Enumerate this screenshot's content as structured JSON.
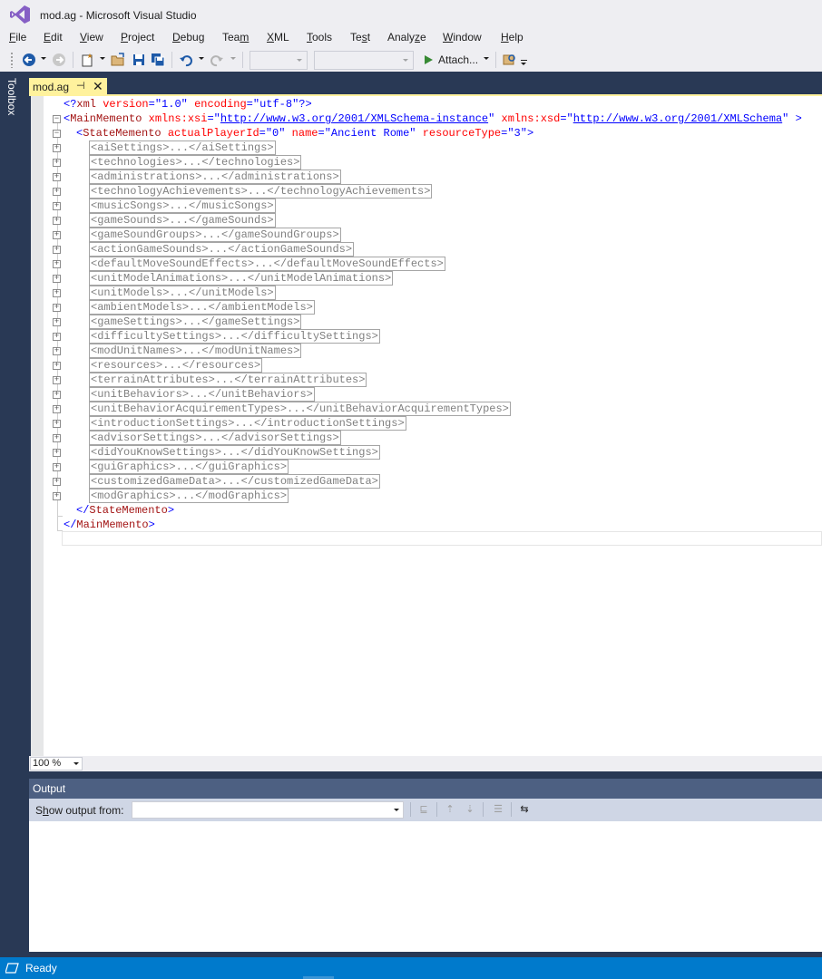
{
  "window": {
    "title": "mod.ag - Microsoft Visual Studio"
  },
  "menu": [
    {
      "label": "File",
      "u": "F",
      "rest": "ile"
    },
    {
      "label": "Edit",
      "u": "E",
      "rest": "dit"
    },
    {
      "label": "View",
      "u": "V",
      "rest": "iew"
    },
    {
      "label": "Project",
      "u": "P",
      "rest": "roject"
    },
    {
      "label": "Debug",
      "u": "D",
      "rest": "ebug"
    },
    {
      "label": "Team",
      "pre": "Tea",
      "u": "m",
      "rest": ""
    },
    {
      "label": "XML",
      "u": "X",
      "rest": "ML"
    },
    {
      "label": "Tools",
      "u": "T",
      "rest": "ools"
    },
    {
      "label": "Test",
      "pre": "Te",
      "u": "s",
      "rest": "t"
    },
    {
      "label": "Analyze",
      "pre": "Analy",
      "u": "z",
      "rest": "e"
    },
    {
      "label": "Window",
      "u": "W",
      "rest": "indow"
    },
    {
      "label": "Help",
      "u": "H",
      "rest": "elp"
    }
  ],
  "toolbar": {
    "attach_label": "Attach..."
  },
  "toolbox": {
    "label": "Toolbox"
  },
  "document_tab": {
    "label": "mod.ag",
    "pin": "⊣",
    "close": "✕"
  },
  "editor": {
    "xml_decl": {
      "open": "<?",
      "name": "xml",
      "attr1": "version",
      "val1": "\"1.0\"",
      "attr2": "encoding",
      "val2": "\"utf-8\"",
      "close": "?>"
    },
    "main_open": {
      "lt": "<",
      "name": "MainMemento",
      "attr1": "xmlns:xsi",
      "val1": "http://www.w3.org/2001/XMLSchema-instance",
      "attr2": "xmlns:xsd",
      "val2": "http://www.w3.org/2001/XMLSchema",
      "gt": ">"
    },
    "state_open": {
      "name": "StateMemento",
      "attr1": "actualPlayerId",
      "val1": "\"0\"",
      "attr2": "name",
      "val2": "\"Ancient Rome\"",
      "attr3": "resourceType",
      "val3": "\"3\""
    },
    "collapsed_nodes": [
      "<aiSettings>...</aiSettings>",
      "<technologies>...</technologies>",
      "<administrations>...</administrations>",
      "<technologyAchievements>...</technologyAchievements>",
      "<musicSongs>...</musicSongs>",
      "<gameSounds>...</gameSounds>",
      "<gameSoundGroups>...</gameSoundGroups>",
      "<actionGameSounds>...</actionGameSounds>",
      "<defaultMoveSoundEffects>...</defaultMoveSoundEffects>",
      "<unitModelAnimations>...</unitModelAnimations>",
      "<unitModels>...</unitModels>",
      "<ambientModels>...</ambientModels>",
      "<gameSettings>...</gameSettings>",
      "<difficultySettings>...</difficultySettings>",
      "<modUnitNames>...</modUnitNames>",
      "<resources>...</resources>",
      "<terrainAttributes>...</terrainAttributes>",
      "<unitBehaviors>...</unitBehaviors>",
      "<unitBehaviorAcquirementTypes>...</unitBehaviorAcquirementTypes>",
      "<introductionSettings>...</introductionSettings>",
      "<advisorSettings>...</advisorSettings>",
      "<didYouKnowSettings>...</didYouKnowSettings>",
      "<guiGraphics>...</guiGraphics>",
      "<customizedGameData>...</customizedGameData>",
      "<modGraphics>...</modGraphics>"
    ],
    "state_close": {
      "open": "</",
      "name": "StateMemento",
      "close": ">"
    },
    "main_close": {
      "open": "</",
      "name": "MainMemento",
      "close": ">"
    },
    "zoom": "100 %"
  },
  "output": {
    "title": "Output",
    "show_from_label": "Show output from:",
    "show_from_u": "h",
    "show_from_value": ""
  },
  "status": {
    "text": "Ready"
  },
  "colors": {
    "accent": "#007acc",
    "tab_active": "#fff29d",
    "panel_dark": "#293955",
    "xml_tag": "#a31515",
    "xml_attr": "#ff0000",
    "xml_delim": "#0000ff",
    "collapsed_text": "#808080"
  }
}
